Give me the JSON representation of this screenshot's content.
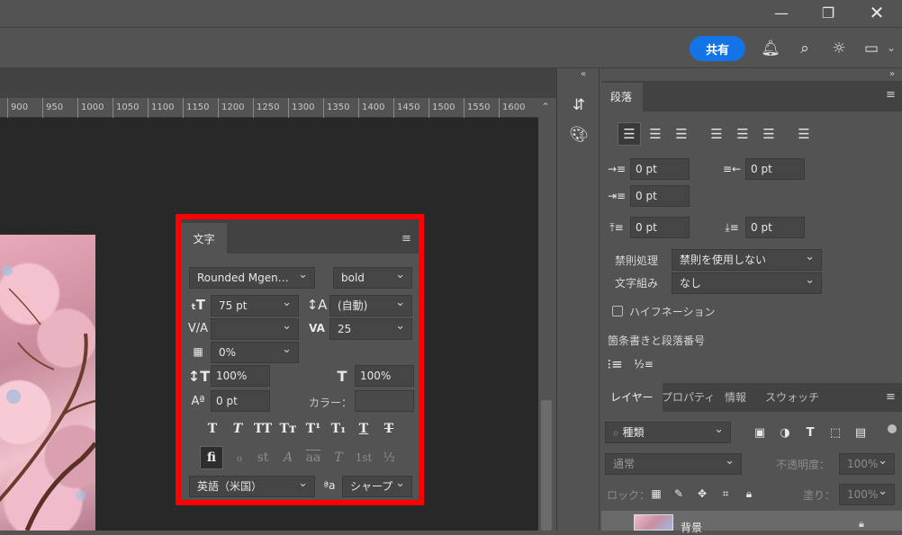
{
  "window": {
    "minimize_icon": "minimize-icon",
    "restore_icon": "restore-icon",
    "close_icon": "close-icon"
  },
  "topbar": {
    "share_label": "共有",
    "icons": [
      "bell-icon",
      "search-icon",
      "lightbulb-icon",
      "workspace-icon"
    ],
    "collapse": "»"
  },
  "ruler": {
    "ticks": [
      "900",
      "950",
      "1000",
      "1050",
      "1100",
      "1150",
      "1200",
      "1250",
      "1300",
      "1350",
      "1400",
      "1450",
      "1500",
      "1550",
      "1600"
    ]
  },
  "character_panel": {
    "tab_label": "文字",
    "font_family": "Rounded Mgen…",
    "font_style": "bold",
    "font_size": "75 pt",
    "leading": "(自動)",
    "kerning": "",
    "tracking": "25",
    "tsume": "0%",
    "vertical_scale": "100%",
    "horizontal_scale": "100%",
    "baseline_shift": "0 pt",
    "color_label": "カラー：",
    "language": "英語（米国）",
    "antialias_label": "ªa",
    "antialias": "シャープ",
    "style_buttons": [
      "T",
      "T",
      "TT",
      "Tт",
      "T¹",
      "T₁",
      "T",
      "T"
    ],
    "opentype_buttons": [
      "fi",
      "ℴ",
      "st",
      "A",
      "aa",
      "T",
      "1st",
      "½"
    ]
  },
  "paragraph_panel": {
    "tab_label": "段落",
    "indent_left": "0 pt",
    "indent_right": "0 pt",
    "indent_first": "0 pt",
    "space_before": "0 pt",
    "space_after": "0 pt",
    "kinsoku_label": "禁則処理",
    "kinsoku_value": "禁則を使用しない",
    "mojikumi_label": "文字組み",
    "mojikumi_value": "なし",
    "hyphenation_label": "ハイフネーション",
    "list_label": "箇条書きと段落番号"
  },
  "layers_panel": {
    "tabs": [
      "レイヤー",
      "プロパティ",
      "情報",
      "スウォッチ"
    ],
    "search_placeholder": "種類",
    "blend_mode": "通常",
    "opacity_label": "不透明度：",
    "opacity_value": "100%",
    "lock_label": "ロック：",
    "fill_label": "塗り：",
    "fill_value": "100%",
    "layer_name": "背景"
  }
}
